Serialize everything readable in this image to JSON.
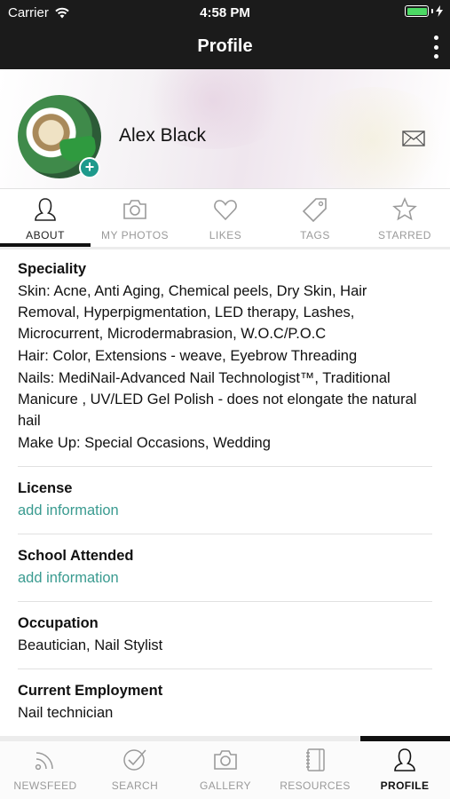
{
  "status_bar": {
    "carrier": "Carrier",
    "time": "4:58 PM",
    "battery_percent": 100,
    "battery_color": "#4cd964"
  },
  "nav": {
    "title": "Profile",
    "menu_icon": "more-vertical-icon"
  },
  "profile": {
    "name": "Alex Black",
    "avatar_badge": "+",
    "mail_icon": "envelope-icon"
  },
  "tabs": [
    {
      "label": "ABOUT",
      "icon": "person-icon",
      "active": true
    },
    {
      "label": "MY PHOTOS",
      "icon": "camera-icon",
      "active": false
    },
    {
      "label": "LIKES",
      "icon": "heart-icon",
      "active": false
    },
    {
      "label": "TAGS",
      "icon": "tag-icon",
      "active": false
    },
    {
      "label": "STARRED",
      "icon": "star-icon",
      "active": false
    }
  ],
  "about": {
    "speciality": {
      "title": "Speciality",
      "lines": [
        "Skin: Acne, Anti Aging, Chemical peels, Dry Skin, Hair Removal, Hyperpigmentation, LED therapy, Lashes, Microcurrent, Microdermabrasion, W.O.C/P.O.C",
        "Hair: Color, Extensions - weave, Eyebrow Threading",
        "Nails: MediNail-Advanced Nail Technologist™, Traditional Manicure , UV/LED Gel Polish - does not elongate the natural hail",
        "Make Up: Special Occasions, Wedding"
      ]
    },
    "license": {
      "title": "License",
      "value": "add information"
    },
    "school": {
      "title": "School Attended",
      "value": "add information"
    },
    "occupation": {
      "title": "Occupation",
      "value": "Beautician, Nail Stylist"
    },
    "employment": {
      "title": "Current Employment",
      "value": "Nail technician"
    }
  },
  "bottom_nav": [
    {
      "label": "NEWSFEED",
      "icon": "rss-icon",
      "active": false
    },
    {
      "label": "SEARCH",
      "icon": "check-search-icon",
      "active": false
    },
    {
      "label": "GALLERY",
      "icon": "camera-icon",
      "active": false
    },
    {
      "label": "RESOURCES",
      "icon": "notebook-icon",
      "active": false
    },
    {
      "label": "PROFILE",
      "icon": "person-icon",
      "active": true
    }
  ],
  "colors": {
    "accent_link": "#3a9b90",
    "badge": "#1e9a8c",
    "bar_background": "#1b1b1b"
  }
}
